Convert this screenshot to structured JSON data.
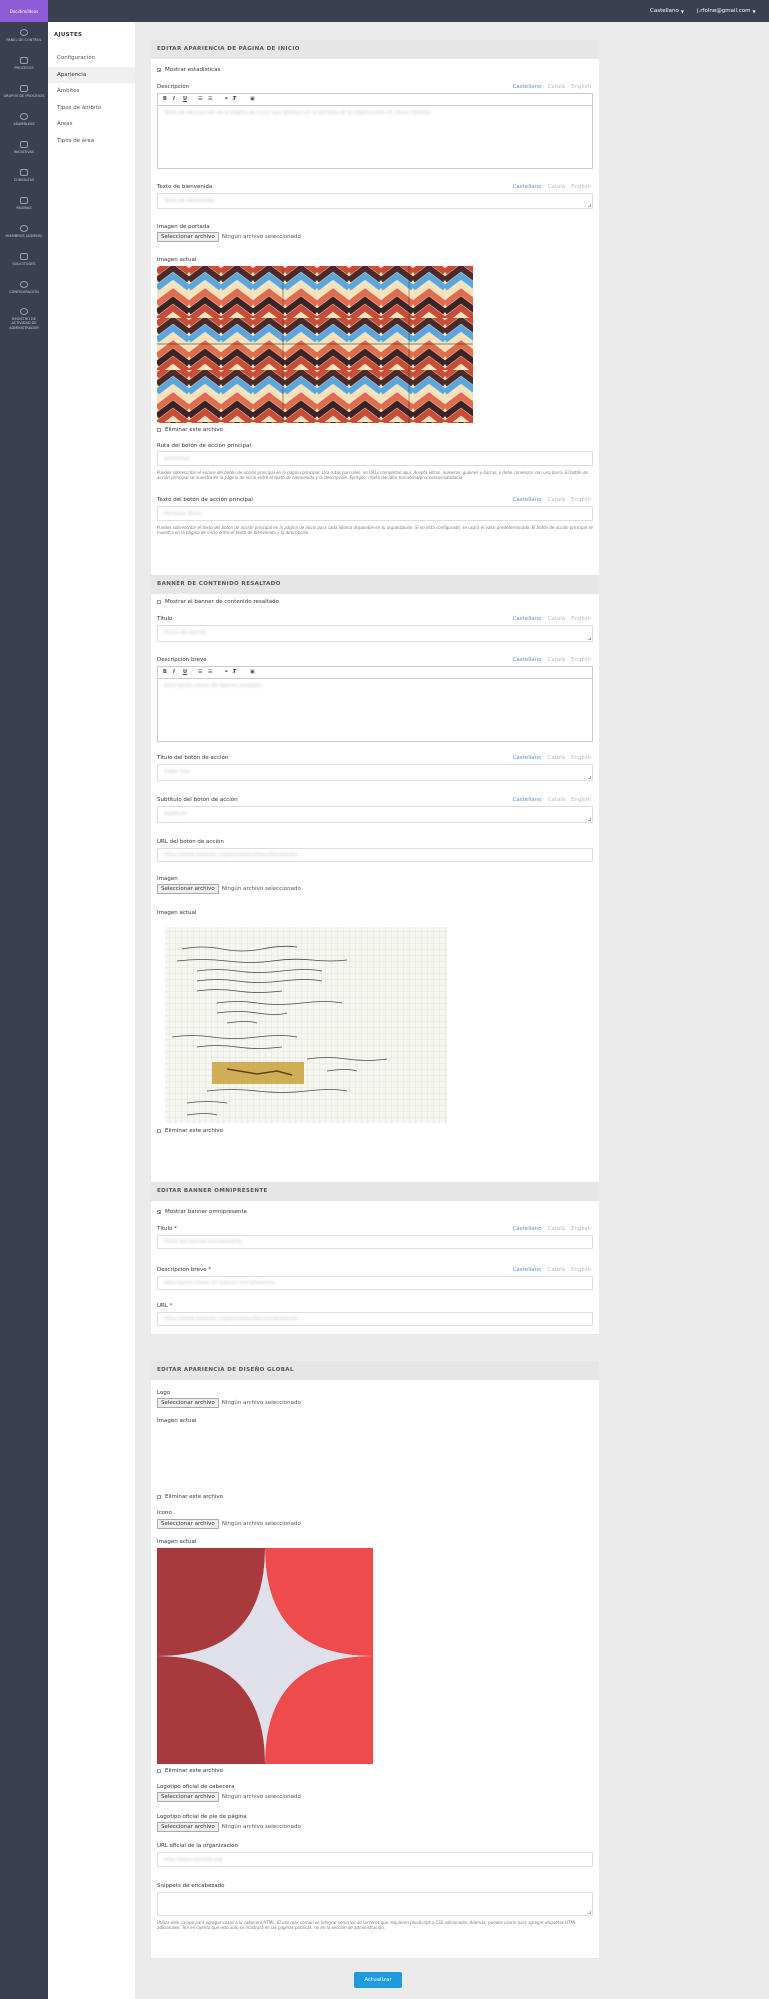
{
  "app": {
    "brand": "Decidim/Ideas"
  },
  "topbar": {
    "language": "Castellano",
    "user": "j.rfolne@gmail.com"
  },
  "sidebar": [
    {
      "label": "PANEL DE CONTROL",
      "icon": "dashboard-icon"
    },
    {
      "label": "PROCESOS",
      "icon": "processes-icon"
    },
    {
      "label": "GRUPOS DE PROCESOS",
      "icon": "process-groups-icon"
    },
    {
      "label": "ASAMBLEAS",
      "icon": "assemblies-icon"
    },
    {
      "label": "INICIATIVAS",
      "icon": "initiatives-icon"
    },
    {
      "label": "CONSULTAS",
      "icon": "consultations-icon"
    },
    {
      "label": "PÁGINAS",
      "icon": "pages-icon"
    },
    {
      "label": "MIEMBROS (ADMINS)",
      "icon": "members-icon"
    },
    {
      "label": "SOLICITUDES",
      "icon": "requests-icon"
    },
    {
      "label": "CONFIGURACIÓN",
      "icon": "settings-icon"
    },
    {
      "label": "REGISTRO DE ACTIVIDAD DE ADMINISTRADOR",
      "icon": "admin-log-icon"
    }
  ],
  "subnav": {
    "title": "AJUSTES",
    "items": [
      "Configuración",
      "Apariencia",
      "Ámbitos",
      "Tipos de ámbito",
      "Áreas",
      "Tipos de área"
    ],
    "active": 1
  },
  "languages": {
    "es": "Castellano",
    "ca": "Català",
    "en": "English"
  },
  "editor_tools": {
    "bold": "B",
    "italic": "I",
    "underline": "U"
  },
  "file": {
    "button": "Seleccionar archivo",
    "none": "Ningún archivo seleccionado"
  },
  "common": {
    "current_image": "Imagen actual",
    "remove_file": "Eliminar este archivo"
  },
  "home": {
    "title": "EDITAR APARIENCIA DE PÁGINA DE INICIO",
    "show_stats": "Mostrar estadísticas",
    "description_label": "Descripción",
    "description_value": "Texto de descripción de la página de inicio que aparece en la portada de la organización en varios idiomas",
    "welcome_label": "Texto de bienvenida",
    "welcome_value": "Texto de bienvenida",
    "cover_label": "Imagen de portada",
    "cta_path_label": "Ruta del botón de acción principal",
    "cta_path_value": "/processes",
    "cta_path_help": "Puedes sobrescribir el enlace del botón de acción principal en la página principal. Usa rutas parciales, no URLs completas aquí. Acepta letras, números, guiones y barras, y debe comenzar con una barra. El botón de acción principal se muestra en la página de inicio entre el texto de bienvenida y la descripción. Ejemplo: /meta-decidim-barcelona/processes/ciutadania",
    "cta_text_label": "Texto del botón de acción principal",
    "cta_text_value": "Participa ahora",
    "cta_text_help": "Puedes sobrescribir el texto del botón de acción principal en la página de inicio para cada idioma disponible en tu organización. Si no está configurado, se usará el valor predeterminado. El botón de acción principal se muestra en la página de inicio entre el texto de bienvenida y la descripción."
  },
  "highlighted": {
    "title": "BANNER DE CONTENIDO RESALTADO",
    "show": "Mostrar el banner de contenido resaltado",
    "title_label": "Título",
    "title_value": "Título del banner",
    "short_desc_label": "Descripción breve",
    "short_desc_value": "Descripción breve del banner resaltado",
    "action_title_label": "Título del botón de acción",
    "action_title_value": "Saber más",
    "action_subtitle_label": "Subtítulo del botón de acción",
    "action_subtitle_value": "Subtítulo",
    "action_url_label": "URL del botón de acción",
    "action_url_value": "https://www.example.org/processes/ideas/f/proposals",
    "image_label": "Imagen"
  },
  "omnipresent": {
    "title": "EDITAR BANNER OMNIPRESENTE",
    "show": "Mostrar banner omnipresente",
    "title_label": "Título *",
    "title_value": "Título del banner omnipresente",
    "desc_label": "Descripción breve *",
    "desc_value": "Descripción breve del banner omnipresente",
    "url_label": "URL *",
    "url_value": "https://www.example.org/processes/banner/proposals"
  },
  "global": {
    "title": "EDITAR APARIENCIA DE DISEÑO GLOBAL",
    "logo_label": "Logo",
    "favicon_label": "Icono",
    "header_logo_label": "Logotipo oficial de cabecera",
    "footer_logo_label": "Logotipo oficial de pie de página",
    "org_url_label": "URL oficial de la organización",
    "org_url_value": "http://www.ejemplo.org",
    "snippets_label": "Snippets de encabezado",
    "snippets_help": "Utiliza este campo para agregar cosas a la cabecera HTML. El uso más común es integrar servicios de terceros que requieren JavaScript o CSS adicionales. Además, puedes usarlo para agregar etiquetas HTML adicionales. Ten en cuenta que esto solo se mostrará en las páginas públicas, no en la sección de administración."
  },
  "submit": "Actualizar",
  "colors": {
    "sidebar": "#3a3f51",
    "brand": "#8f5bd6",
    "primary": "#1e9be0",
    "favicon_dark": "#a8393c",
    "favicon_light": "#ee4b4c"
  }
}
